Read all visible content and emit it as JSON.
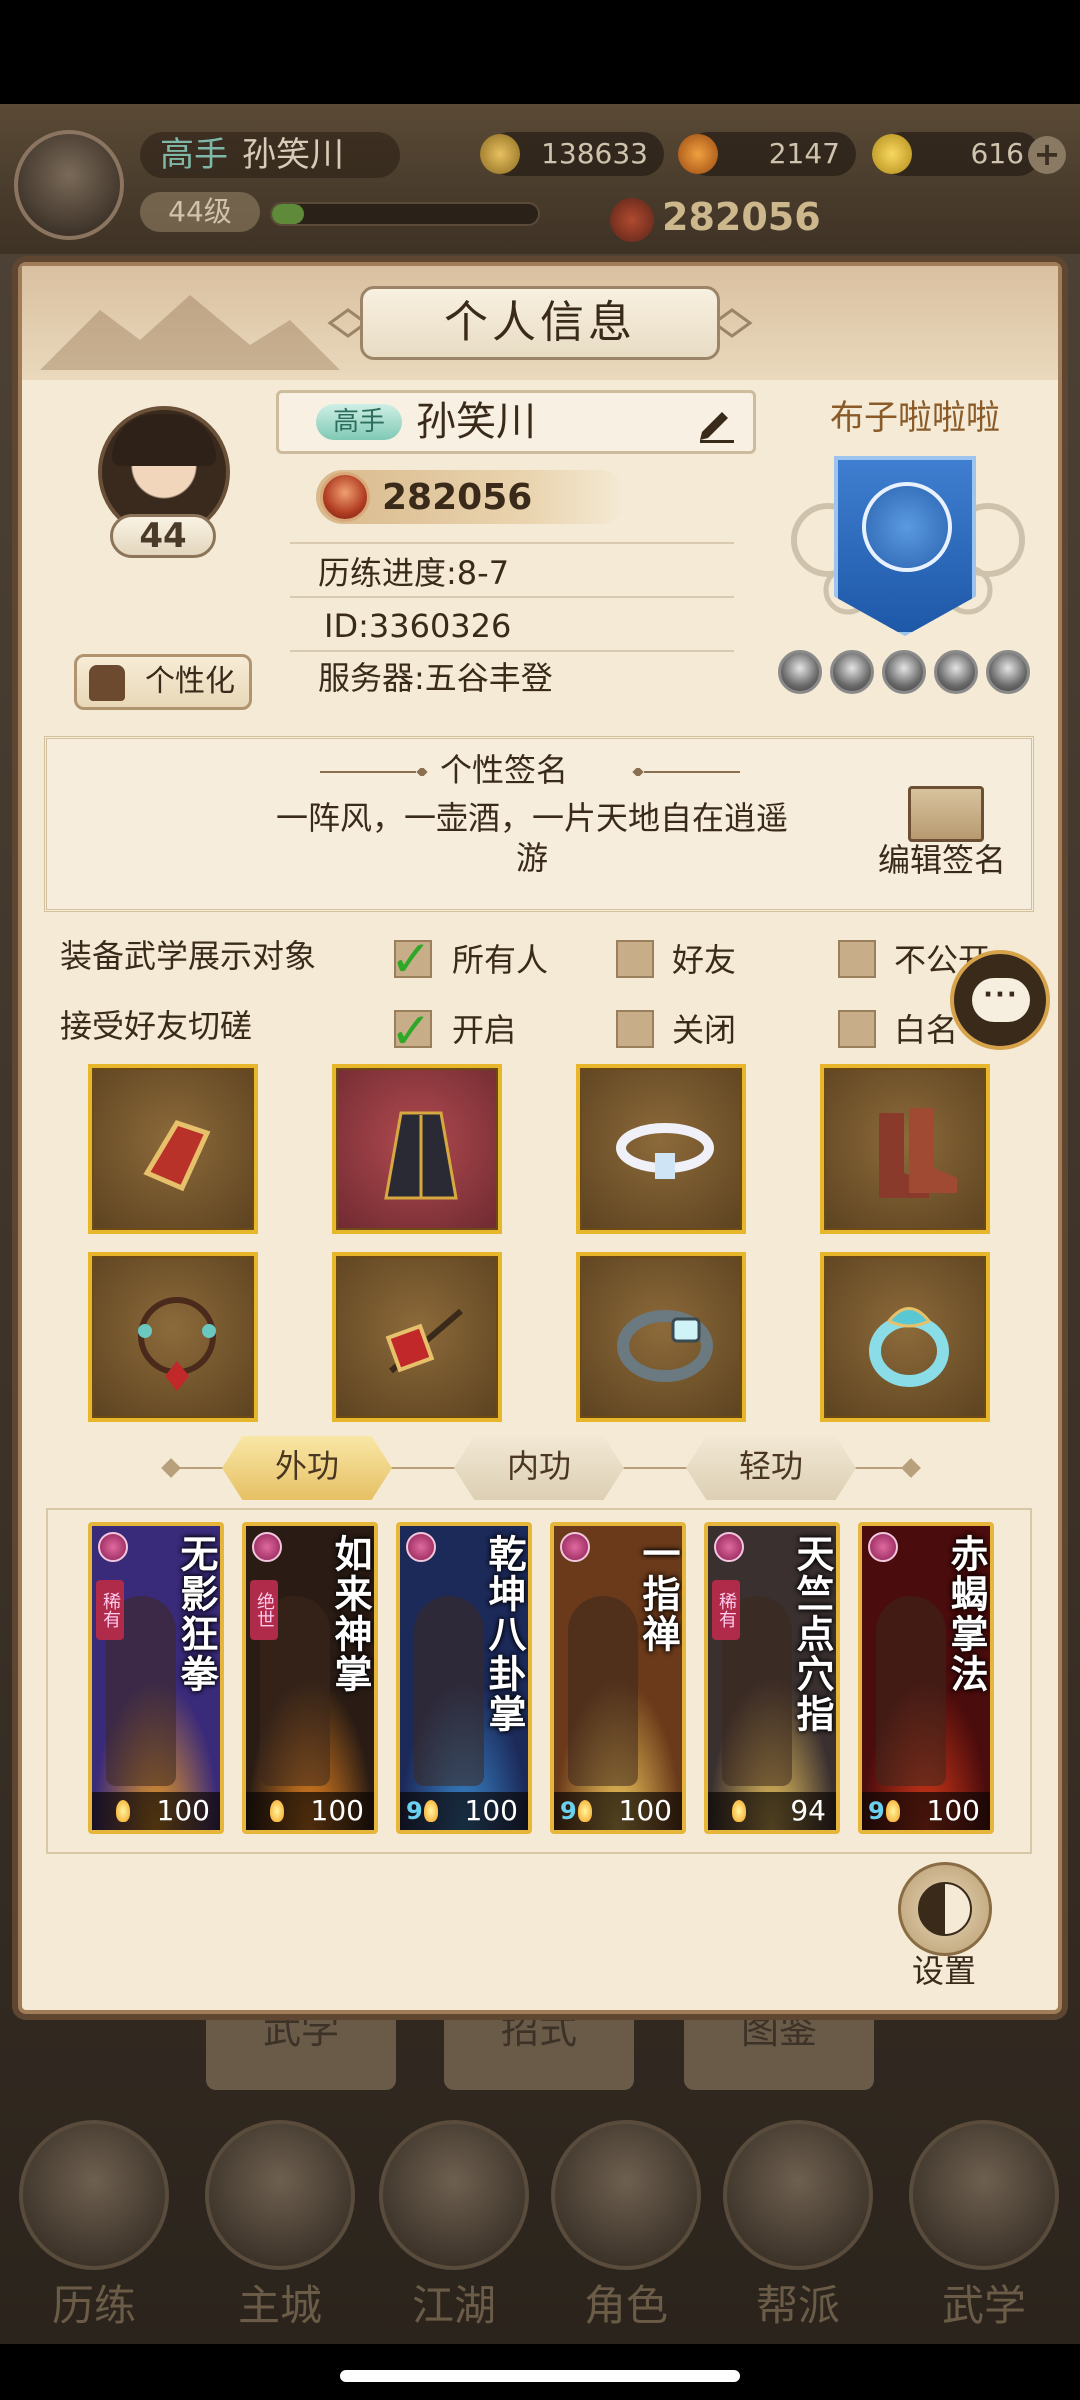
{
  "hud": {
    "rank_tag": "高手",
    "player_name": "孙笑川",
    "level": "44级",
    "exp_fraction": 0.12,
    "copper": "138633",
    "ingot": "2147",
    "gold": "616",
    "power": "282056"
  },
  "panel": {
    "title": "个人信息",
    "profile": {
      "level": "44",
      "personalize_label": "个性化",
      "rank_tag": "高手",
      "name": "孙笑川",
      "power": "282056",
      "progress": "历练进度:8-7",
      "id": "ID:3360326",
      "server": "服务器:五谷丰登"
    },
    "guild": {
      "name": "布子啦啦啦"
    },
    "signature": {
      "title": "个性签名",
      "text": "一阵风，一壶酒，一片天地自在逍遥游",
      "edit_label": "编辑签名"
    },
    "settings": {
      "display_label": "装备武学展示对象",
      "display_options": [
        "所有人",
        "好友",
        "不公开"
      ],
      "display_checked": [
        true,
        false,
        false
      ],
      "spar_label": "接受好友切磋",
      "spar_options": [
        "开启",
        "关闭",
        "白名"
      ],
      "spar_checked": [
        true,
        false,
        false
      ]
    },
    "equipment": [
      {
        "icon": "bracer-icon"
      },
      {
        "icon": "robe-icon"
      },
      {
        "icon": "belt-icon"
      },
      {
        "icon": "boots-icon"
      },
      {
        "icon": "bead-bracelet-icon"
      },
      {
        "icon": "hairpin-icon"
      },
      {
        "icon": "bracelet-icon"
      },
      {
        "icon": "ring-icon"
      }
    ],
    "skill_tabs": [
      "外功",
      "内功",
      "轻功"
    ],
    "active_tab": 0,
    "skills": [
      {
        "name": "无影狂拳",
        "rarity": "稀有",
        "level": "100",
        "nine": ""
      },
      {
        "name": "如来神掌",
        "rarity": "绝世",
        "level": "100",
        "nine": ""
      },
      {
        "name": "乾坤八卦掌",
        "rarity": "",
        "level": "100",
        "nine": "9"
      },
      {
        "name": "一指禅",
        "rarity": "",
        "level": "100",
        "nine": "9"
      },
      {
        "name": "天竺点穴指",
        "rarity": "稀有",
        "level": "94",
        "nine": ""
      },
      {
        "name": "赤蝎掌法",
        "rarity": "",
        "level": "100",
        "nine": "9"
      }
    ],
    "settings_label": "设置"
  },
  "background": {
    "tabs": [
      "武学",
      "招式",
      "图鉴"
    ],
    "nav": [
      "历练",
      "主城",
      "江湖",
      "角色",
      "帮派",
      "武学"
    ]
  },
  "colors": {
    "panel_bg": "#f4ead6",
    "gold_border": "#e7b62a",
    "check_green": "#2fa82a"
  }
}
